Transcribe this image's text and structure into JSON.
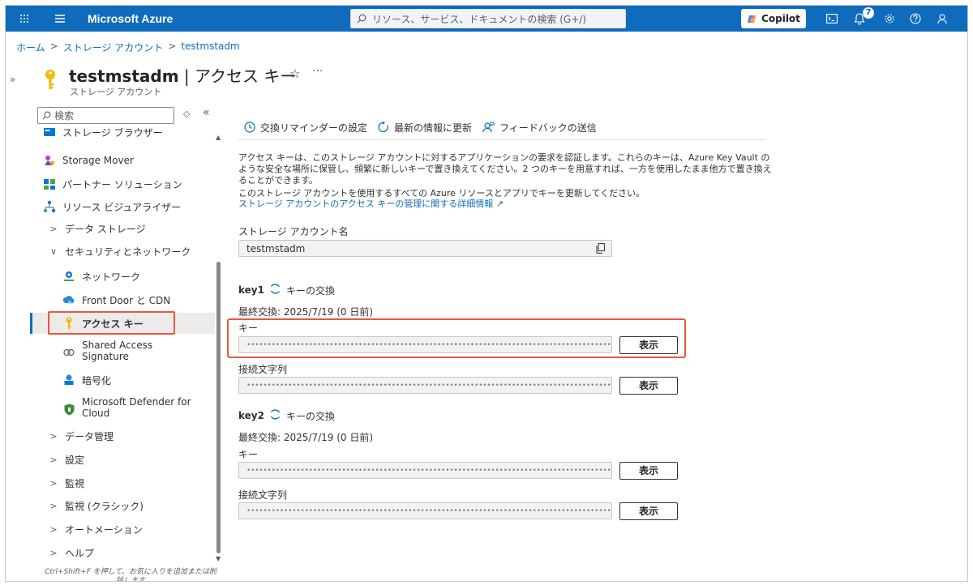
{
  "app": {
    "title": "Microsoft Azure"
  },
  "search": {
    "placeholder": "リソース、サービス、ドキュメントの検索 (G+/)"
  },
  "copilot": {
    "label": "Copilot"
  },
  "notifications": {
    "count": "7"
  },
  "breadcrumb": [
    "ホーム",
    "ストレージ アカウント",
    "testmstadm"
  ],
  "resource": {
    "name": "testmstadm",
    "page": "アクセス キー",
    "separator": "|",
    "subtitle": "ストレージ アカウント"
  },
  "nav": {
    "search_placeholder": "検索",
    "items": [
      {
        "label": "ストレージ ブラウザー"
      },
      {
        "label": "Storage Mover"
      },
      {
        "label": "パートナー ソリューション"
      },
      {
        "label": "リソース ビジュアライザー"
      },
      {
        "label": "データ ストレージ"
      },
      {
        "label": "セキュリティとネットワーク"
      },
      {
        "label": "ネットワーク"
      },
      {
        "label": "Front Door と CDN"
      },
      {
        "label": "アクセス キー"
      },
      {
        "label": "Shared Access",
        "label2": "Signature"
      },
      {
        "label": "暗号化"
      },
      {
        "label": "Microsoft Defender for",
        "label2": "Cloud"
      },
      {
        "label": "データ管理"
      },
      {
        "label": "設定"
      },
      {
        "label": "監視"
      },
      {
        "label": "監視 (クラシック)"
      },
      {
        "label": "オートメーション"
      },
      {
        "label": "ヘルプ"
      }
    ],
    "hint": "Ctrl+Shift+F を押して、お気に入りを追加または削除します"
  },
  "toolbar": {
    "reminder": "交換リマインダーの設定",
    "refresh": "最新の情報に更新",
    "feedback": "フィードバックの送信"
  },
  "main": {
    "description": "アクセス キーは、このストレージ アカウントに対するアプリケーションの要求を認証します。これらのキーは、Azure Key Vault のような安全な場所に保管し、頻繁に新しいキーで置き換えてください。2 つのキーを用意すれば、一方を使用したまま他方で置き換えることができます。",
    "update_note": "このストレージ アカウントを使用するすべての Azure リソースとアプリでキーを更新してください。",
    "learn_more": "ストレージ アカウントのアクセス キーの管理に関する詳細情報",
    "account_label": "ストレージ アカウント名",
    "account_value": "testmstadm",
    "mask": "••••••••••••••••••••••••••••••••••••••••••••••••••••••••••••••••••••••••••••••••••••••••••••",
    "keys": [
      {
        "name": "key1",
        "rotate": "キーの交換",
        "last_rotated": "最終交換: 2025/7/19 (0 日前)",
        "key_label": "キー",
        "conn_label": "接続文字列",
        "show": "表示"
      },
      {
        "name": "key2",
        "rotate": "キーの交換",
        "last_rotated": "最終交換: 2025/7/19 (0 日前)",
        "key_label": "キー",
        "conn_label": "接続文字列",
        "show": "表示"
      }
    ]
  }
}
